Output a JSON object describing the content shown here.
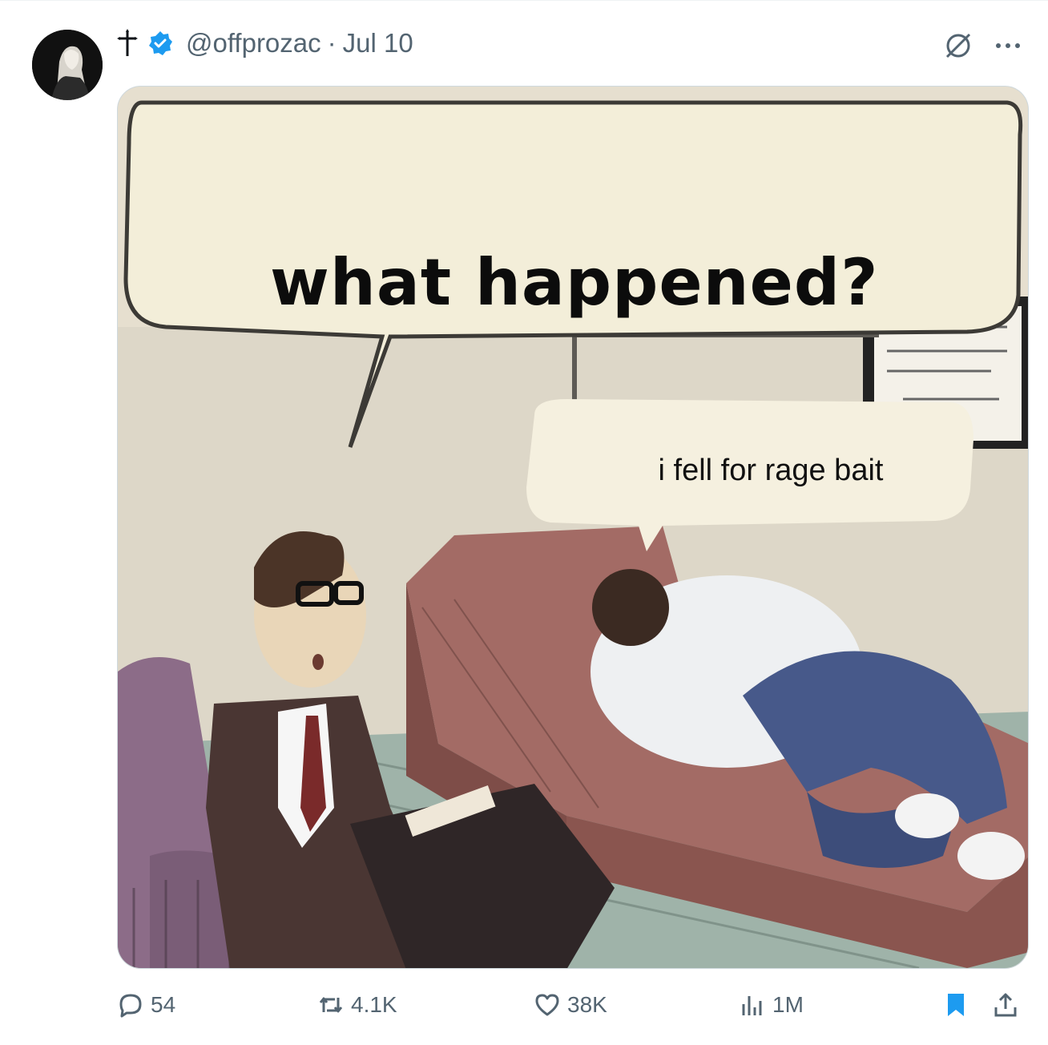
{
  "post": {
    "handle": "@offprozac",
    "separator": "·",
    "date": "Jul 10"
  },
  "meme": {
    "bubble_top": "what happened?",
    "bubble_bottom": "i fell for rage bait"
  },
  "actions": {
    "replies": "54",
    "reposts": "4.1K",
    "likes": "38K",
    "views": "1M"
  },
  "colors": {
    "verified": "#1d9bf0",
    "bookmark": "#1d9bf0",
    "muted": "#536471"
  },
  "icons": [
    "cross-icon",
    "verified-badge-icon",
    "grok-icon",
    "more-icon",
    "reply-icon",
    "repost-icon",
    "like-icon",
    "views-icon",
    "bookmark-icon",
    "share-icon"
  ]
}
